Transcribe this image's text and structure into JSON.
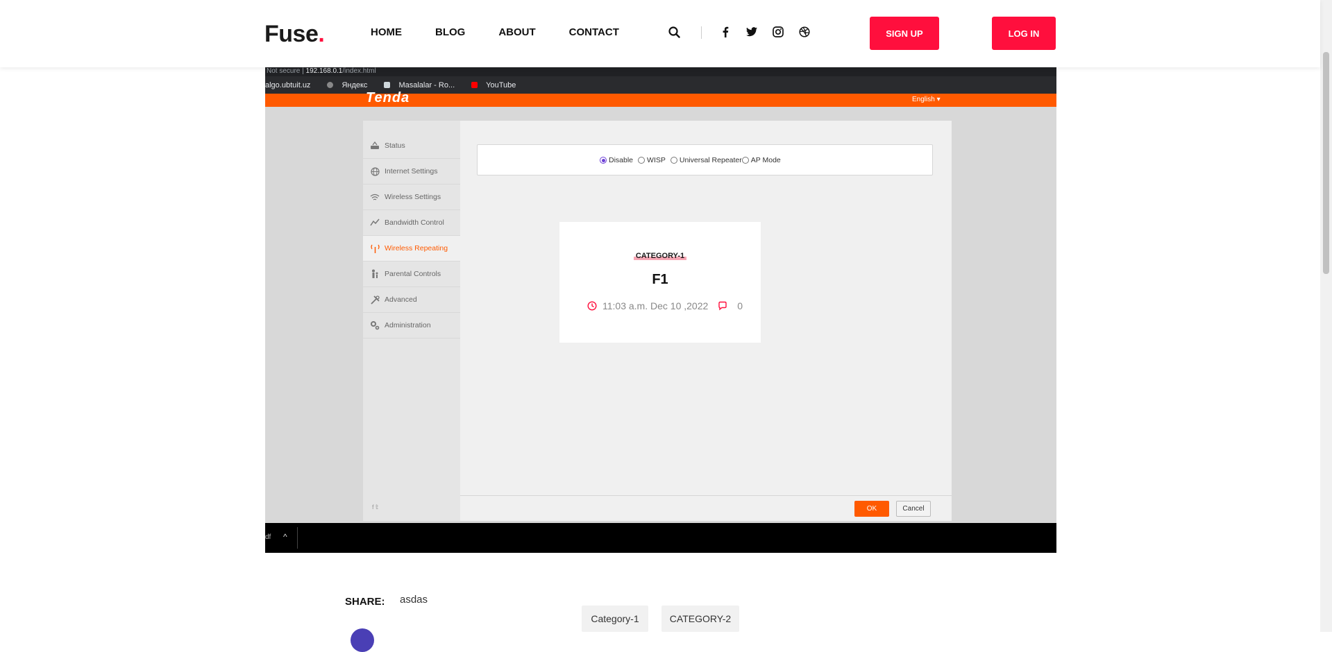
{
  "header": {
    "logo_text": "Fuse",
    "logo_dot": ".",
    "nav": [
      "HOME",
      "BLOG",
      "ABOUT",
      "CONTACT"
    ],
    "signup_label": "SIGN UP",
    "login_label": "LOG IN",
    "icons": [
      "search-icon",
      "facebook-icon",
      "twitter-icon",
      "instagram-icon",
      "dribbble-icon"
    ]
  },
  "screenshot": {
    "address_prefix": "Not secure  |",
    "address_host": "192.168.0.1",
    "address_path": "/index.html",
    "bookmarks": [
      "algo.ubtuit.uz",
      "Яндекс",
      "Masalalar - Ro...",
      "YouTube"
    ],
    "brand": "Tenda",
    "language": "English ▾",
    "menu": [
      {
        "label": "Status",
        "icon": "router-icon",
        "active": false
      },
      {
        "label": "Internet Settings",
        "icon": "globe-icon",
        "active": false
      },
      {
        "label": "Wireless Settings",
        "icon": "wifi-icon",
        "active": false
      },
      {
        "label": "Bandwidth Control",
        "icon": "chart-icon",
        "active": false
      },
      {
        "label": "Wireless Repeating",
        "icon": "antenna-icon",
        "active": true
      },
      {
        "label": "Parental Controls",
        "icon": "parent-icon",
        "active": false
      },
      {
        "label": "Advanced",
        "icon": "tools-icon",
        "active": false
      },
      {
        "label": "Administration",
        "icon": "gears-icon",
        "active": false
      }
    ],
    "social": "f  𝕥",
    "modes": [
      {
        "label": "Disable",
        "selected": true
      },
      {
        "label": "WISP",
        "selected": false
      },
      {
        "label": "Universal Repeater",
        "selected": false
      },
      {
        "label": "AP Mode",
        "selected": false
      }
    ],
    "ok_label": "OK",
    "cancel_label": "Cancel",
    "taskbar_text": "df",
    "taskbar_arrow": "^"
  },
  "card": {
    "category": "CATEGORY-1",
    "title": "F1",
    "datetime": "11:03 a.m. Dec 10 ,2022",
    "comments": "0"
  },
  "footer": {
    "share_label": "SHARE:",
    "share_text": "asdas",
    "tags": [
      "Category-1",
      "CATEGORY-2"
    ]
  },
  "colors": {
    "brand_red": "#ff0f3d",
    "tenda_orange": "#ff5a00",
    "radio_purple": "#6c3fd6"
  }
}
